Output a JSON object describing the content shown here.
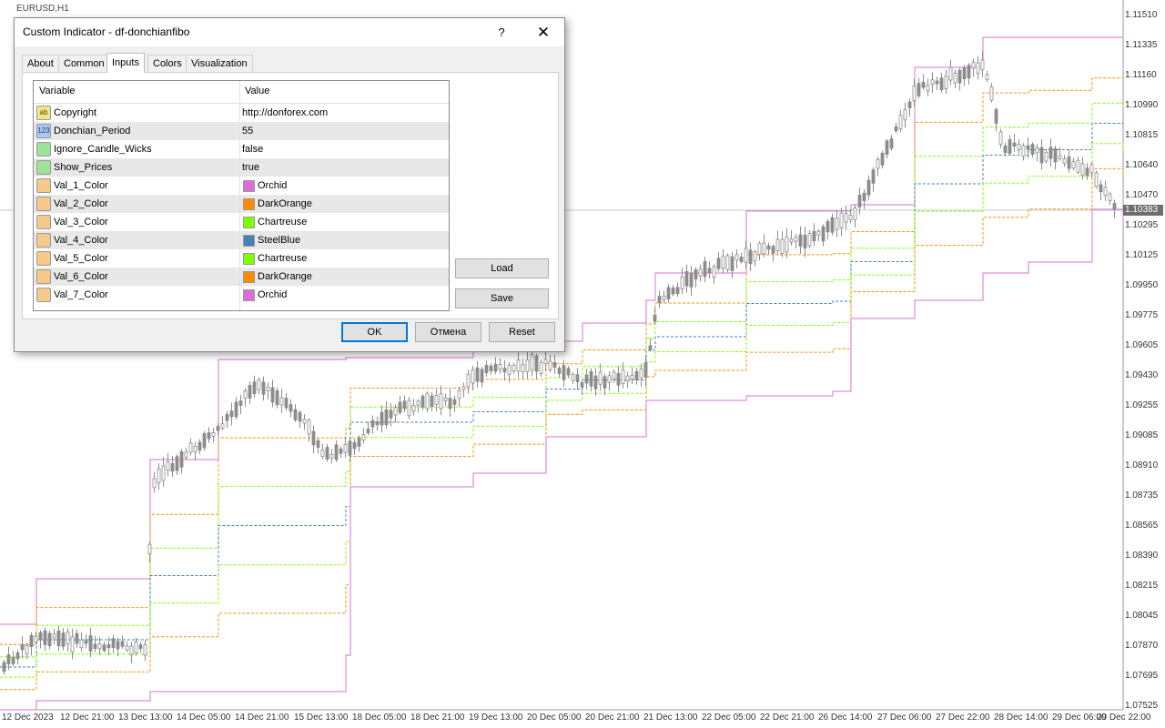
{
  "chart": {
    "symbol": "EURUSD,H1",
    "current_price": "1.10383",
    "price_axis": [
      "1.11510",
      "1.11335",
      "1.11160",
      "1.10990",
      "1.10815",
      "1.10640",
      "1.10470",
      "1.10295",
      "1.10125",
      "1.09950",
      "1.09775",
      "1.09605",
      "1.09430",
      "1.09255",
      "1.09085",
      "1.08910",
      "1.08735",
      "1.08565",
      "1.08390",
      "1.08215",
      "1.08045",
      "1.07870",
      "1.07695",
      "1.07525"
    ],
    "time_axis": [
      "12 Dec 2023",
      "12 Dec 21:00",
      "13 Dec 13:00",
      "14 Dec 05:00",
      "14 Dec 21:00",
      "15 Dec 13:00",
      "18 Dec 05:00",
      "18 Dec 21:00",
      "19 Dec 13:00",
      "20 Dec 05:00",
      "20 Dec 21:00",
      "21 Dec 13:00",
      "22 Dec 05:00",
      "22 Dec 21:00",
      "26 Dec 14:00",
      "27 Dec 06:00",
      "27 Dec 22:00",
      "28 Dec 14:00",
      "29 Dec 06:00",
      "29 Dec 22:00"
    ],
    "colors": {
      "orchid": "#da70d6",
      "darkorange": "#ff8c00",
      "chartreuse": "#7fff00",
      "steelblue": "#4682b4",
      "candle": "#8c8c8c"
    }
  },
  "dialog": {
    "title": "Custom Indicator - df-donchianfibo",
    "help_label": "?",
    "close_label": "✕",
    "tabs": [
      {
        "label": "About"
      },
      {
        "label": "Common"
      },
      {
        "label": "Inputs"
      },
      {
        "label": "Colors"
      },
      {
        "label": "Visualization"
      }
    ],
    "active_tab": "Inputs",
    "grid": {
      "col_variable": "Variable",
      "col_value": "Value",
      "rows": [
        {
          "icon": "string-type-icon",
          "icon_text": "ab",
          "name": "Copyright",
          "value": "http://donforex.com"
        },
        {
          "icon": "int-type-icon",
          "icon_text": "123",
          "name": "Donchian_Period",
          "value": "55"
        },
        {
          "icon": "bool-type-icon",
          "icon_text": "",
          "name": "Ignore_Candle_Wicks",
          "value": "false"
        },
        {
          "icon": "bool-type-icon",
          "icon_text": "",
          "name": "Show_Prices",
          "value": "true"
        },
        {
          "icon": "color-type-icon",
          "icon_text": "",
          "name": "Val_1_Color",
          "value": "Orchid",
          "swatch": "#da70d6"
        },
        {
          "icon": "color-type-icon",
          "icon_text": "",
          "name": "Val_2_Color",
          "value": "DarkOrange",
          "swatch": "#ff8c00"
        },
        {
          "icon": "color-type-icon",
          "icon_text": "",
          "name": "Val_3_Color",
          "value": "Chartreuse",
          "swatch": "#7fff00"
        },
        {
          "icon": "color-type-icon",
          "icon_text": "",
          "name": "Val_4_Color",
          "value": "SteelBlue",
          "swatch": "#4682b4"
        },
        {
          "icon": "color-type-icon",
          "icon_text": "",
          "name": "Val_5_Color",
          "value": "Chartreuse",
          "swatch": "#7fff00"
        },
        {
          "icon": "color-type-icon",
          "icon_text": "",
          "name": "Val_6_Color",
          "value": "DarkOrange",
          "swatch": "#ff8c00"
        },
        {
          "icon": "color-type-icon",
          "icon_text": "",
          "name": "Val_7_Color",
          "value": "Orchid",
          "swatch": "#da70d6"
        }
      ]
    },
    "load_label": "Load",
    "save_label": "Save",
    "ok_label": "OK",
    "cancel_label": "Отмена",
    "reset_label": "Reset"
  }
}
